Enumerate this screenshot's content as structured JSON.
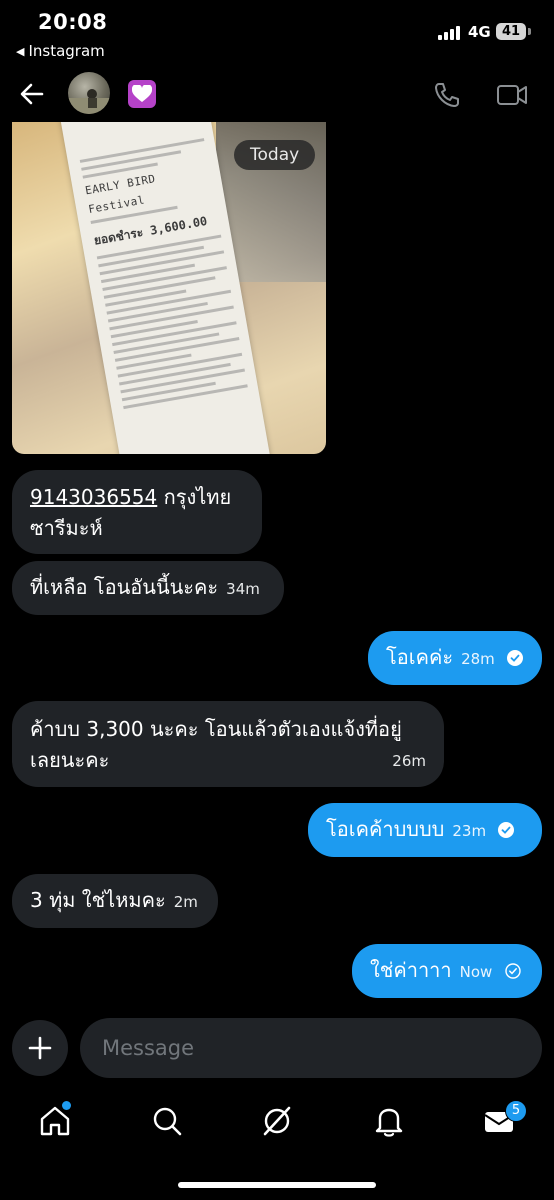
{
  "status_bar": {
    "time": "20:08",
    "back_app": "Instagram",
    "network": "4G",
    "battery": "41"
  },
  "conversation": {
    "date_separator": "Today"
  },
  "messages": [
    {
      "dir": "in",
      "account": "9143036554",
      "line1_rest": " กรุงไทย",
      "line2": "ซารีมะห์"
    },
    {
      "dir": "in",
      "text": "ที่เหลือ โอนอันนี้นะคะ",
      "time": "34m"
    },
    {
      "dir": "out",
      "text": "โอเคค่ะ",
      "time": "28m"
    },
    {
      "dir": "in",
      "text_line1": "ค้าบบ 3,300 นะคะ โอนแล้วตัวเองแจ้งที่อยู่",
      "text_line2": "เลยนะคะ",
      "time": "26m"
    },
    {
      "dir": "out",
      "text": "โอเคค้าบบบบ",
      "time": "23m"
    },
    {
      "dir": "in",
      "text": "3 ทุ่ม ใช่ไหมคะ",
      "time": "2m"
    },
    {
      "dir": "out",
      "text": "ใช่ค่าาาา",
      "time": "Now"
    }
  ],
  "receipt": {
    "title1": "EARLY BIRD",
    "title2": "Festival",
    "amount": "3,600.00",
    "label": "ยอดชำระ"
  },
  "composer": {
    "placeholder": "Message"
  },
  "tabs": {
    "messages_badge": "5"
  },
  "colors": {
    "accent": "#1d9bf0",
    "incoming_bubble": "#202327"
  }
}
